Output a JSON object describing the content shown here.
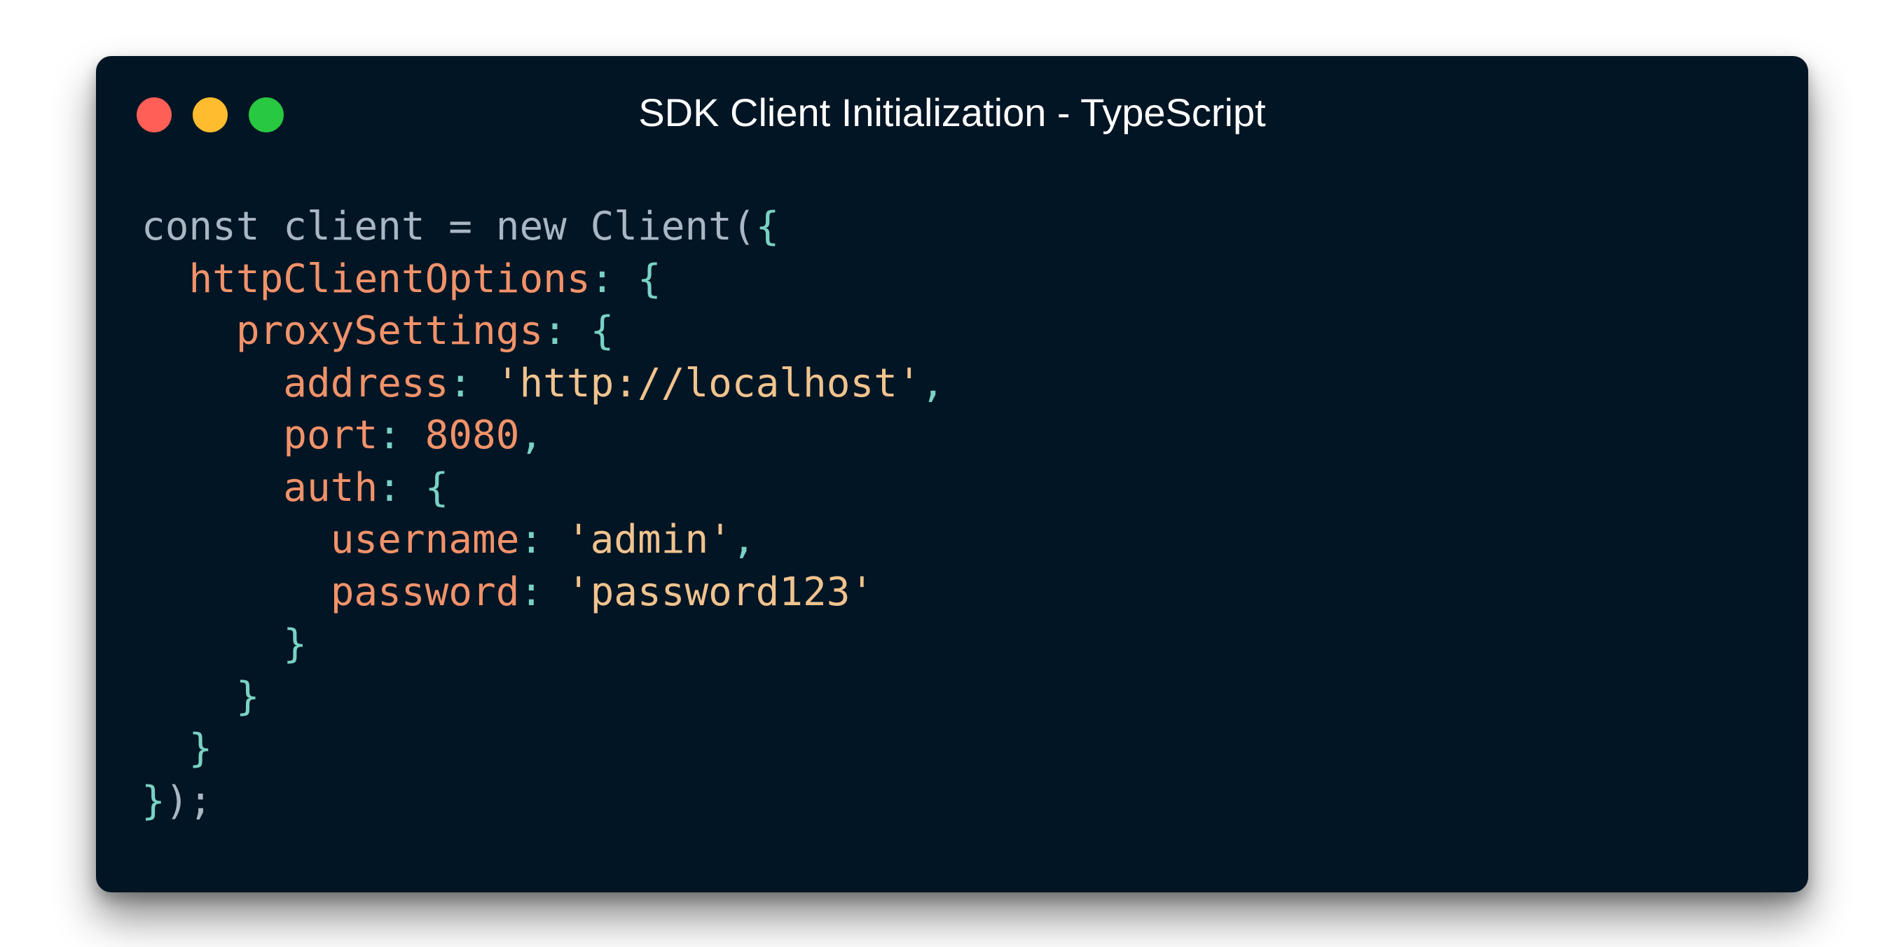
{
  "window": {
    "title": "SDK Client Initialization - TypeScript",
    "traffic_lights": [
      {
        "name": "close-button",
        "color": "#ff5f57"
      },
      {
        "name": "minimize-button",
        "color": "#febc2e"
      },
      {
        "name": "zoom-button",
        "color": "#28c840"
      }
    ]
  },
  "colors": {
    "background": "#021524",
    "plain": "#a9b6c4",
    "punct": "#79d2c4",
    "key": "#f2926a",
    "string": "#f0c38e",
    "number": "#f2926a"
  },
  "code": {
    "language": "TypeScript",
    "lines": [
      [
        [
          "plain",
          "const client = new Client("
        ],
        [
          "punct",
          "{"
        ]
      ],
      [
        [
          "plain",
          "  "
        ],
        [
          "key",
          "httpClientOptions"
        ],
        [
          "punct",
          ": {"
        ]
      ],
      [
        [
          "plain",
          "    "
        ],
        [
          "key",
          "proxySettings"
        ],
        [
          "punct",
          ": {"
        ]
      ],
      [
        [
          "plain",
          "      "
        ],
        [
          "key",
          "address"
        ],
        [
          "punct",
          ": "
        ],
        [
          "string",
          "'http://localhost'"
        ],
        [
          "punct",
          ","
        ]
      ],
      [
        [
          "plain",
          "      "
        ],
        [
          "key",
          "port"
        ],
        [
          "punct",
          ": "
        ],
        [
          "number",
          "8080"
        ],
        [
          "punct",
          ","
        ]
      ],
      [
        [
          "plain",
          "      "
        ],
        [
          "key",
          "auth"
        ],
        [
          "punct",
          ": {"
        ]
      ],
      [
        [
          "plain",
          "        "
        ],
        [
          "key",
          "username"
        ],
        [
          "punct",
          ": "
        ],
        [
          "string",
          "'admin'"
        ],
        [
          "punct",
          ","
        ]
      ],
      [
        [
          "plain",
          "        "
        ],
        [
          "key",
          "password"
        ],
        [
          "punct",
          ": "
        ],
        [
          "string",
          "'password123'"
        ]
      ],
      [
        [
          "plain",
          "      "
        ],
        [
          "punct",
          "}"
        ]
      ],
      [
        [
          "plain",
          "    "
        ],
        [
          "punct",
          "}"
        ]
      ],
      [
        [
          "plain",
          "  "
        ],
        [
          "punct",
          "}"
        ]
      ],
      [
        [
          "punct",
          "}"
        ],
        [
          "plain",
          ");"
        ]
      ]
    ]
  }
}
